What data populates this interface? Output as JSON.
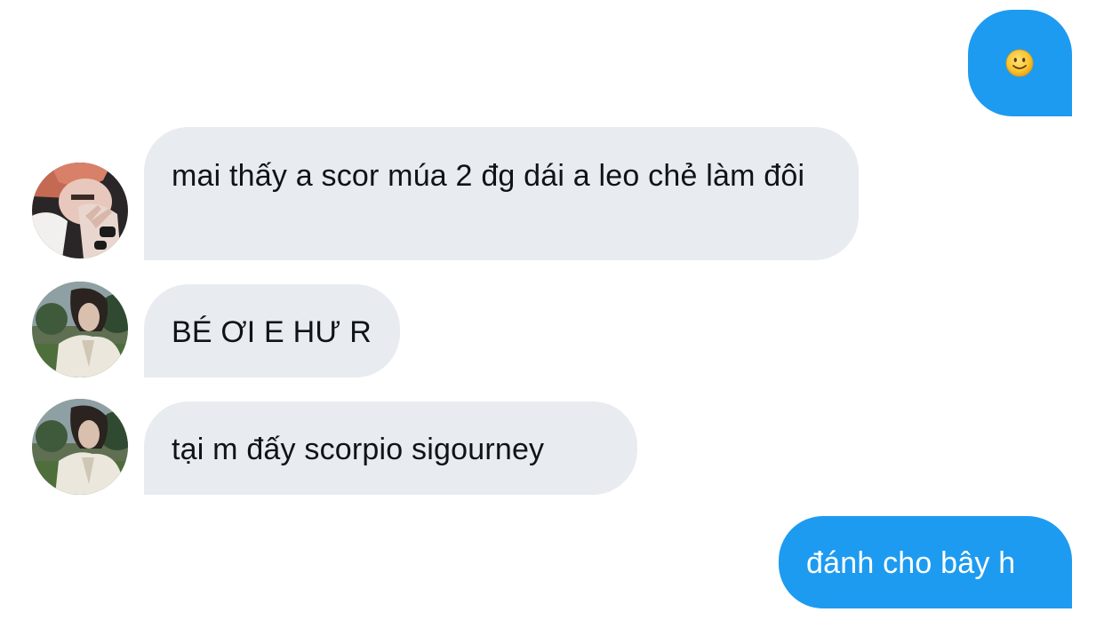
{
  "messages": [
    {
      "direction": "outgoing",
      "emoji": "slightly-smiling-face-emoji"
    },
    {
      "direction": "incoming",
      "sender_avatar": "avatar-user-a",
      "text": "mai thấy a scor múa 2 đg dái a leo chẻ làm đôi"
    },
    {
      "direction": "incoming",
      "sender_avatar": "avatar-user-b",
      "text": "BÉ ƠI E HƯ R"
    },
    {
      "direction": "incoming",
      "sender_avatar": "avatar-user-b",
      "text": "tại m đấy scorpio sigourney"
    },
    {
      "direction": "outgoing",
      "text": "đánh cho bây h"
    }
  ],
  "colors": {
    "outgoing_bubble": "#1d9bf0",
    "incoming_bubble": "#e8ecf0",
    "incoming_text": "#0f1419",
    "outgoing_text": "#ffffff"
  }
}
